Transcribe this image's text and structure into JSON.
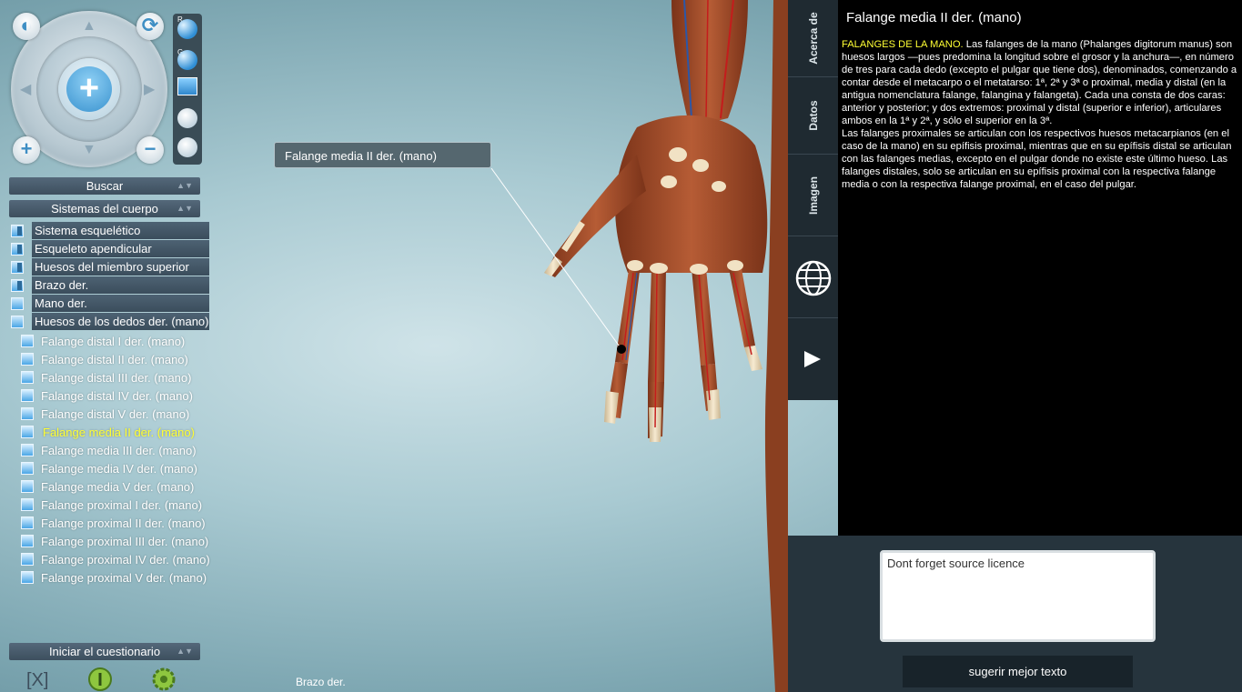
{
  "viewport": {
    "callout_label": "Falange media II der. (mano)",
    "status_text": "Brazo der."
  },
  "nav": {
    "icons": [
      "reset-view-icon",
      "rotate-icon",
      "zoom-in-icon",
      "zoom-out-icon",
      "pan-up-icon",
      "pan-down-icon",
      "pan-left-icon",
      "pan-right-icon",
      "center-plus-icon"
    ],
    "slider_r_label": "R",
    "slider_g_label": "G"
  },
  "left_panel": {
    "search_label": "Buscar",
    "systems_label": "Sistemas del cuerpo",
    "tree": [
      "Sistema esquelético",
      "Esqueleto apendicular",
      "Huesos del miembro superior",
      "Brazo der.",
      "Mano der.",
      "Huesos de los dedos der. (mano)"
    ],
    "leaves": [
      "Falange distal I der. (mano)",
      "Falange distal II der. (mano)",
      "Falange distal III der. (mano)",
      "Falange distal IV der. (mano)",
      "Falange distal V der. (mano)",
      "Falange media II der. (mano)",
      "Falange media III der. (mano)",
      "Falange media IV der. (mano)",
      "Falange media V der. (mano)",
      "Falange proximal I der. (mano)",
      "Falange proximal II der. (mano)",
      "Falange proximal III der. (mano)",
      "Falange proximal IV der. (mano)",
      "Falange proximal V der. (mano)"
    ],
    "selected_leaf": "Falange media II der. (mano)",
    "quiz_label": "Iniciar el cuestionario"
  },
  "right_panel": {
    "tabs": [
      "Acerca de",
      "Datos",
      "Imagen"
    ],
    "title": "Falange media II der. (mano)",
    "highlight": "FALANGES DE LA MANO.",
    "paragraph1": " Las falanges de la mano (Phalanges digitorum manus) son huesos largos —pues predomina la longitud sobre el grosor y la anchura—, en número de tres para cada dedo (excepto el pulgar que tiene dos), denominados, comenzando a contar desde el metacarpo o el metatarso: 1ª, 2ª y 3ª o proximal, media y distal (en la antigua nomenclatura falange, falangina y falangeta). Cada una consta de dos caras: anterior y posterior; y dos extremos: proximal y distal (superior e inferior), articulares ambos en la 1ª y 2ª, y sólo el superior en la 3ª.",
    "paragraph2": "Las falanges proximales se articulan con los respectivos huesos metacarpianos (en el caso de la mano) en su epífisis proximal, mientras que en su epífisis distal se articulan con las falanges medias, excepto en el pulgar donde no existe este último hueso. Las falanges distales, solo se articulan en su epífisis proximal con la respectiva falange media o con la respectiva falange proximal, en el caso del pulgar.",
    "note_text": "Dont forget source licence",
    "suggest_label": "sugerir mejor texto"
  },
  "colors": {
    "highlight": "#ffff33",
    "muscle": "#a9532f",
    "bone": "#f1e2c4",
    "panel_bg": "#000000"
  }
}
